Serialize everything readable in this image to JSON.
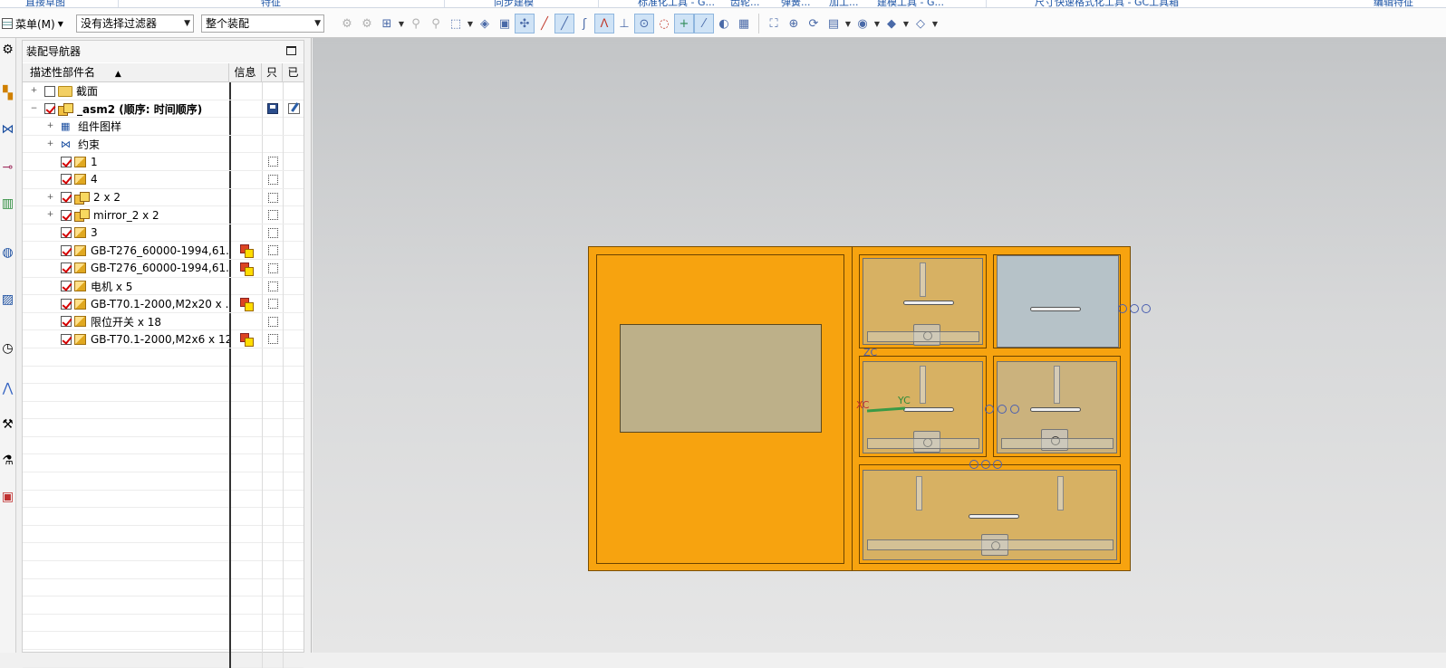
{
  "ribbon": {
    "groups": [
      "直接草图",
      "特征",
      "同步建模",
      "标准化工具 - G...",
      "齿轮...",
      "弹簧...",
      "加工...",
      "建模工具 - G...",
      "尺寸快速格式化工具 - GC工具箱",
      "编辑特征"
    ]
  },
  "toolbar": {
    "menu_label": "菜单(M)",
    "filter_value": "没有选择过滤器",
    "scope_value": "整个装配"
  },
  "navigator": {
    "title": "装配导航器",
    "columns": {
      "name": "描述性部件名",
      "info": "信息",
      "readonly": "只",
      "modified": "已"
    },
    "rows": [
      {
        "name": "截面",
        "checked": false,
        "icon": "folder-icon",
        "expander": "+",
        "indent": 0
      },
      {
        "name": "_asm2 (顺序: 时间顺序)",
        "checked": true,
        "icon": "assembly-icon",
        "expander": "−",
        "indent": 0,
        "bold": true
      },
      {
        "name": "组件图样",
        "checked": null,
        "icon": "pattern-icon",
        "expander": "+",
        "indent": 1
      },
      {
        "name": "约束",
        "checked": null,
        "icon": "constraint-icon",
        "expander": "+",
        "indent": 1
      },
      {
        "name": "1",
        "checked": true,
        "icon": "part-icon",
        "expander": "",
        "indent": 1
      },
      {
        "name": "4",
        "checked": true,
        "icon": "part-icon",
        "expander": "",
        "indent": 1
      },
      {
        "name": "2 x 2",
        "checked": true,
        "icon": "assembly-icon",
        "expander": "+",
        "indent": 1
      },
      {
        "name": "mirror_2 x 2",
        "checked": true,
        "icon": "assembly-icon",
        "expander": "+",
        "indent": 1
      },
      {
        "name": "3",
        "checked": true,
        "icon": "part-icon",
        "expander": "",
        "indent": 1
      },
      {
        "name": "GB-T276_60000-1994,61...",
        "checked": true,
        "icon": "part-icon",
        "expander": "",
        "indent": 1,
        "info": true
      },
      {
        "name": "GB-T276_60000-1994,61...",
        "checked": true,
        "icon": "part-icon",
        "expander": "",
        "indent": 1,
        "info": true
      },
      {
        "name": "电机 x 5",
        "checked": true,
        "icon": "part-icon",
        "expander": "",
        "indent": 1
      },
      {
        "name": "GB-T70.1-2000,M2x20 x ...",
        "checked": true,
        "icon": "part-icon",
        "expander": "",
        "indent": 1,
        "info": true
      },
      {
        "name": "限位开关 x 18",
        "checked": true,
        "icon": "part-icon",
        "expander": "",
        "indent": 1
      },
      {
        "name": "GB-T70.1-2000,M2x6 x 12",
        "checked": true,
        "icon": "part-icon",
        "expander": "",
        "indent": 1,
        "info": true
      }
    ]
  },
  "viewport": {
    "axis_labels": {
      "z": "ZC",
      "x": "XC",
      "y": "YC"
    },
    "colors": {
      "body": "#f7a30f",
      "background_top": "#c3c5c7",
      "background_bottom": "#e6e6e6"
    }
  }
}
